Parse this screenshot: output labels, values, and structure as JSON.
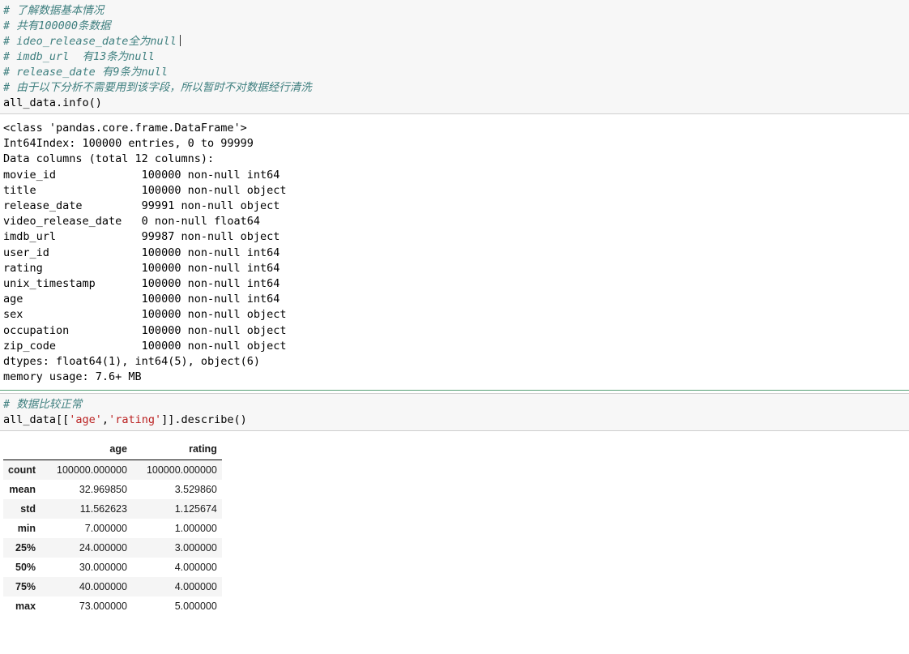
{
  "cells": [
    {
      "id": "cell-1",
      "kind": "code",
      "lines": [
        {
          "type": "comment",
          "text": "# 了解数据基本情况"
        },
        {
          "type": "comment",
          "text": "# 共有100000条数据"
        },
        {
          "type": "comment",
          "text": "# ideo_release_date全为null",
          "caret": true
        },
        {
          "type": "comment",
          "text": "# imdb_url  有13条为null"
        },
        {
          "type": "comment",
          "text": "# release_date 有9条为null"
        },
        {
          "type": "comment",
          "text": "# 由于以下分析不需要用到该字段，所以暂时不对数据经行清洗"
        },
        {
          "type": "code",
          "text": "all_data.info()"
        }
      ]
    }
  ],
  "info_output": {
    "lines": [
      "<class 'pandas.core.frame.DataFrame'>",
      "Int64Index: 100000 entries, 0 to 99999",
      "Data columns (total 12 columns):",
      "movie_id             100000 non-null int64",
      "title                100000 non-null object",
      "release_date         99991 non-null object",
      "video_release_date   0 non-null float64",
      "imdb_url             99987 non-null object",
      "user_id              100000 non-null int64",
      "rating               100000 non-null int64",
      "unix_timestamp       100000 non-null int64",
      "age                  100000 non-null int64",
      "sex                  100000 non-null object",
      "occupation           100000 non-null object",
      "zip_code             100000 non-null object",
      "dtypes: float64(1), int64(5), object(6)",
      "memory usage: 7.6+ MB"
    ]
  },
  "cell2": {
    "comment": "# 数据比较正常",
    "code_prefix": "all_data[[",
    "str1": "'age'",
    "code_mid": ",",
    "str2": "'rating'",
    "code_suffix": "]].describe()"
  },
  "describe_table": {
    "corner_label": "",
    "columns": [
      "age",
      "rating"
    ],
    "rows": [
      {
        "index": "count",
        "values": [
          "100000.000000",
          "100000.000000"
        ]
      },
      {
        "index": "mean",
        "values": [
          "32.969850",
          "3.529860"
        ]
      },
      {
        "index": "std",
        "values": [
          "11.562623",
          "1.125674"
        ]
      },
      {
        "index": "min",
        "values": [
          "7.000000",
          "1.000000"
        ]
      },
      {
        "index": "25%",
        "values": [
          "24.000000",
          "3.000000"
        ]
      },
      {
        "index": "50%",
        "values": [
          "30.000000",
          "4.000000"
        ]
      },
      {
        "index": "75%",
        "values": [
          "40.000000",
          "4.000000"
        ]
      },
      {
        "index": "max",
        "values": [
          "73.000000",
          "5.000000"
        ]
      }
    ]
  },
  "colors": {
    "comment": "#408080",
    "string": "#ba2121",
    "cell_background": "#f7f7f7",
    "cell_border": "#cfcfcf",
    "separator": "#58a177",
    "row_stripe": "#f5f5f5"
  }
}
